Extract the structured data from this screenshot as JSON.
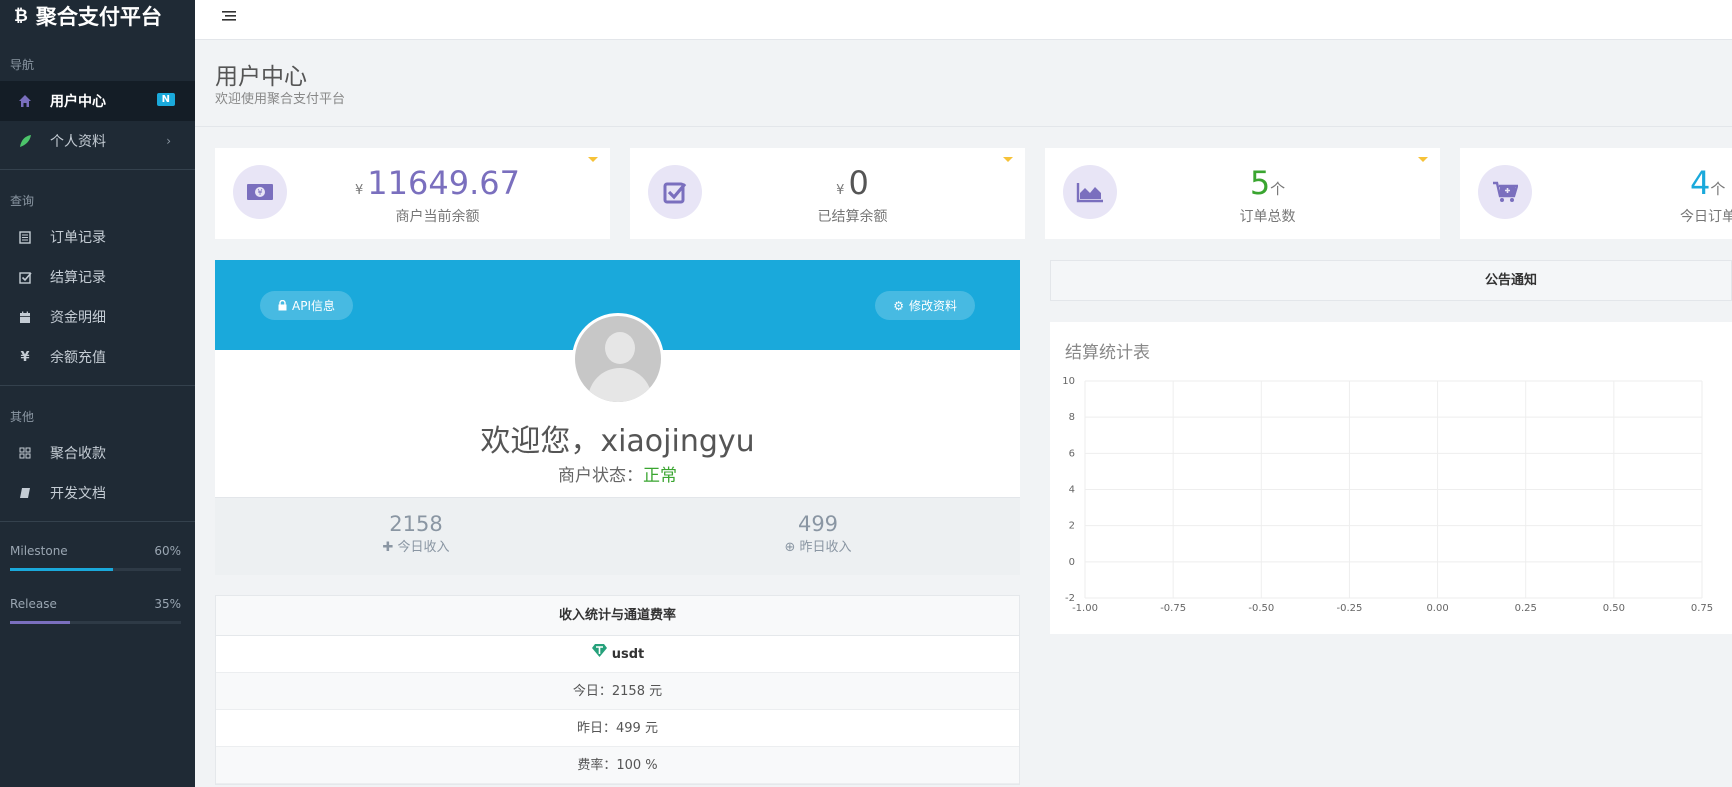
{
  "brand": {
    "title": "聚合支付平台",
    "icon": "bitcoin-icon"
  },
  "sidebar": {
    "sections": [
      {
        "title": "导航",
        "items": [
          {
            "label": "用户中心",
            "icon": "home-icon",
            "active": true,
            "badge": "N"
          },
          {
            "label": "个人资料",
            "icon": "leaf-icon",
            "chevron": true
          }
        ]
      },
      {
        "title": "查询",
        "items": [
          {
            "label": "订单记录",
            "icon": "list-icon"
          },
          {
            "label": "结算记录",
            "icon": "check-square-icon"
          },
          {
            "label": "资金明细",
            "icon": "calendar-icon"
          },
          {
            "label": "余额充值",
            "icon": "yen-icon"
          }
        ]
      },
      {
        "title": "其他",
        "items": [
          {
            "label": "聚合收款",
            "icon": "grid-icon"
          },
          {
            "label": "开发文档",
            "icon": "book-icon"
          }
        ]
      }
    ],
    "progress": [
      {
        "label": "Milestone",
        "value": "60%",
        "fraction": 0.6,
        "color": "#1aa9db"
      },
      {
        "label": "Release",
        "value": "35%",
        "fraction": 0.35,
        "color": "#7a6fbe"
      }
    ]
  },
  "header": {
    "title": "用户中心",
    "subtitle": "欢迎使用聚合支付平台"
  },
  "stats": [
    {
      "currency": "¥",
      "value": "11649.67",
      "unit": "",
      "label": "商户当前余额",
      "icon": "money-icon",
      "color": "#7a6fbe"
    },
    {
      "currency": "¥",
      "value": "0",
      "unit": "",
      "label": "已结算余额",
      "icon": "check-icon",
      "color": "#555555"
    },
    {
      "currency": "",
      "value": "5",
      "unit": "个",
      "label": "订单总数",
      "icon": "area-chart-icon",
      "color": "#3aa530"
    },
    {
      "currency": "",
      "value": "4",
      "unit": "个",
      "label": "今日订单",
      "icon": "cart-icon",
      "color": "#1aa9db"
    }
  ],
  "profile": {
    "api_button": "API信息",
    "edit_button": "修改资料",
    "welcome_prefix": "欢迎您，",
    "username": "xiaojingyu",
    "status_label": "商户状态：",
    "status_value": "正常",
    "today_income": {
      "value": "2158",
      "label": "今日收入"
    },
    "yesterday_income": {
      "value": "499",
      "label": "昨日收入"
    }
  },
  "income_table": {
    "title": "收入统计与通道费率",
    "channel": "usdt",
    "today": "今日：2158 元",
    "yesterday": "昨日：499 元",
    "rate": "费率：100 %"
  },
  "notice": {
    "title": "公告通知"
  },
  "chart_data": {
    "type": "line",
    "title": "结算统计表",
    "x": [],
    "series": [],
    "xlim": [
      -1.0,
      0.75
    ],
    "ylim": [
      -2,
      10
    ],
    "xticks": [
      "-1.00",
      "-0.75",
      "-0.50",
      "-0.25",
      "0.00",
      "0.25",
      "0.50",
      "0.75"
    ],
    "yticks": [
      "10",
      "8",
      "6",
      "4",
      "2",
      "0",
      "-2"
    ],
    "grid": true
  }
}
